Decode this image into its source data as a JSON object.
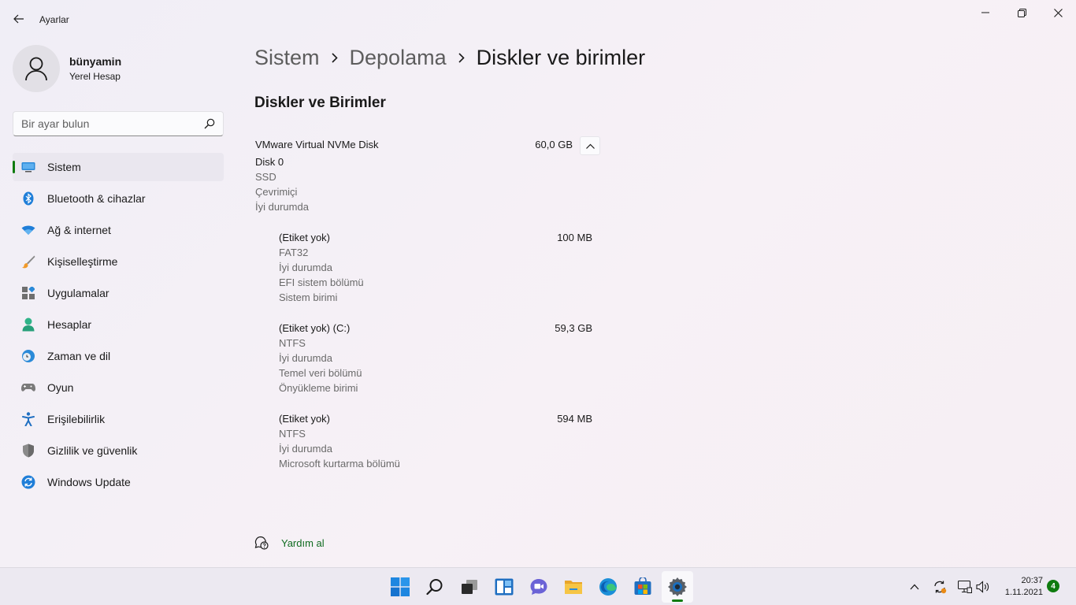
{
  "window": {
    "app_title": "Ayarlar"
  },
  "profile": {
    "name": "bünyamin",
    "account_type": "Yerel Hesap"
  },
  "search": {
    "placeholder": "Bir ayar bulun"
  },
  "sidebar": {
    "items": [
      {
        "label": "Sistem",
        "icon": "system-icon",
        "active": true
      },
      {
        "label": "Bluetooth & cihazlar",
        "icon": "bluetooth-icon"
      },
      {
        "label": "Ağ & internet",
        "icon": "wifi-icon"
      },
      {
        "label": "Kişiselleştirme",
        "icon": "brush-icon"
      },
      {
        "label": "Uygulamalar",
        "icon": "apps-icon"
      },
      {
        "label": "Hesaplar",
        "icon": "accounts-icon"
      },
      {
        "label": "Zaman ve dil",
        "icon": "time-language-icon"
      },
      {
        "label": "Oyun",
        "icon": "gaming-icon"
      },
      {
        "label": "Erişilebilirlik",
        "icon": "accessibility-icon"
      },
      {
        "label": "Gizlilik ve güvenlik",
        "icon": "shield-icon"
      },
      {
        "label": "Windows Update",
        "icon": "windows-update-icon"
      }
    ]
  },
  "breadcrumb": {
    "items": [
      "Sistem",
      "Depolama"
    ],
    "current": "Diskler ve birimler"
  },
  "section_title": "Diskler ve Birimler",
  "disk": {
    "name": "VMware Virtual NVMe Disk",
    "size": "60,0 GB",
    "number": "Disk 0",
    "type": "SSD",
    "status_online": "Çevrimiçi",
    "health": "İyi durumda"
  },
  "volumes": [
    {
      "name": "(Etiket yok)",
      "size": "100 MB",
      "lines": [
        "FAT32",
        "İyi durumda",
        "EFI sistem bölümü",
        "Sistem birimi"
      ]
    },
    {
      "name": "(Etiket yok) (C:)",
      "size": "59,3 GB",
      "lines": [
        "NTFS",
        "İyi durumda",
        "Temel veri bölümü",
        "Önyükleme birimi"
      ]
    },
    {
      "name": "(Etiket yok)",
      "size": "594 MB",
      "lines": [
        "NTFS",
        "İyi durumda",
        "Microsoft kurtarma bölümü"
      ]
    }
  ],
  "help": {
    "label": "Yardım al"
  },
  "taskbar": {
    "apps": [
      "start-icon",
      "search-icon",
      "task-view-icon",
      "widgets-icon",
      "chat-icon",
      "file-explorer-icon",
      "edge-icon",
      "store-icon",
      "settings-icon"
    ],
    "active_app": "settings-icon",
    "clock_time": "20:37",
    "clock_date": "1.11.2021",
    "notification_count": "4"
  },
  "colors": {
    "accent": "#0f7b0f",
    "link": "#0f6b20",
    "background": "#f3f0f5"
  }
}
